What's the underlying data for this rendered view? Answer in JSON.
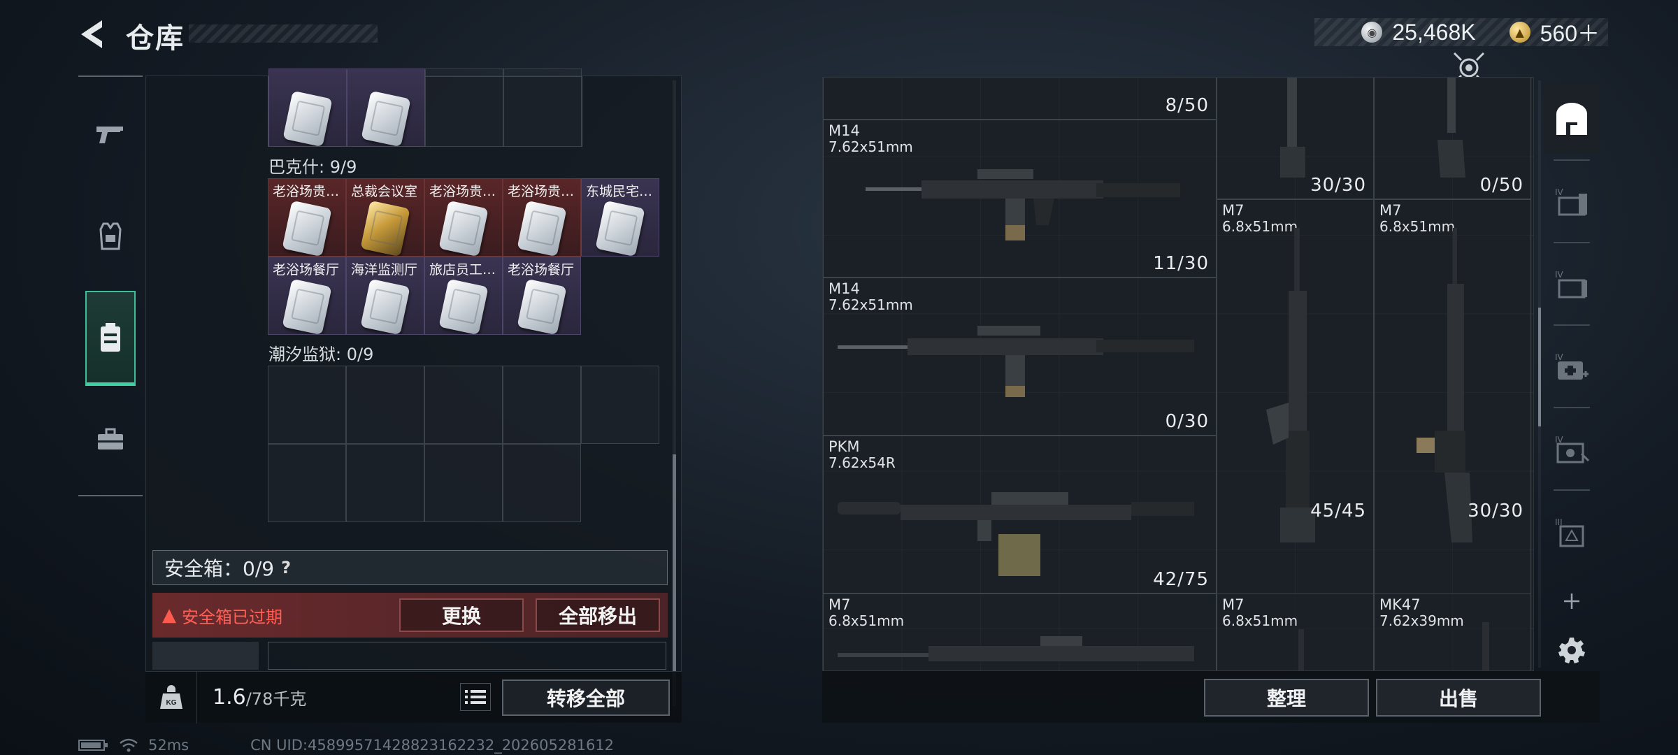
{
  "header": {
    "title": "仓库"
  },
  "currency": {
    "silver": "25,468K",
    "gold": "560＋"
  },
  "left_nav": [
    {
      "id": "weapons",
      "icon": "pistol-icon"
    },
    {
      "id": "armor",
      "icon": "vest-icon"
    },
    {
      "id": "cards",
      "icon": "keycard-case-icon",
      "active": true
    },
    {
      "id": "cases",
      "icon": "toolbox-icon"
    }
  ],
  "inventory": {
    "sections": [
      {
        "label": "巴克什: 9/9",
        "items": [
          {
            "name": "老浴场贵…",
            "rarity": "red"
          },
          {
            "name": "总裁会议室",
            "rarity": "red",
            "gold": true
          },
          {
            "name": "老浴场贵…",
            "rarity": "red"
          },
          {
            "name": "老浴场贵…",
            "rarity": "red"
          },
          {
            "name": "东城民宅…",
            "rarity": "purple"
          },
          {
            "name": "老浴场餐厅",
            "rarity": "purple"
          },
          {
            "name": "海洋监测厅",
            "rarity": "purple"
          },
          {
            "name": "旅店员工…",
            "rarity": "purple"
          },
          {
            "name": "老浴场餐厅",
            "rarity": "purple"
          }
        ]
      },
      {
        "label": "潮汐监狱: 0/9"
      }
    ],
    "safe_box": {
      "label": "安全箱：0/9",
      "help": "?",
      "status": "安全箱已过期",
      "replace_label": "更换",
      "remove_all_label": "全部移出"
    },
    "weight": {
      "current": "1.6",
      "max": "/78千克"
    },
    "transfer_all_label": "转移全部"
  },
  "stash": {
    "items": [
      {
        "name": "",
        "caliber": "",
        "ammo": "8/50"
      },
      {
        "name": "",
        "caliber": "",
        "ammo": "30/30"
      },
      {
        "name": "",
        "caliber": "",
        "ammo": "0/50"
      },
      {
        "name": "M14",
        "caliber": "7.62x51mm",
        "ammo": "11/30"
      },
      {
        "name": "M7",
        "caliber": "6.8x51mm",
        "ammo": "45/45"
      },
      {
        "name": "M7",
        "caliber": "6.8x51mm",
        "ammo": "30/30"
      },
      {
        "name": "M14",
        "caliber": "7.62x51mm",
        "ammo": "0/30"
      },
      {
        "name": "PKM",
        "caliber": "7.62x54R",
        "ammo": "42/75"
      },
      {
        "name": "M7",
        "caliber": "6.8x51mm",
        "ammo": ""
      },
      {
        "name": "M7",
        "caliber": "6.8x51mm",
        "ammo": ""
      },
      {
        "name": "MK47",
        "caliber": "7.62x39mm",
        "ammo": ""
      }
    ],
    "sort_label": "整理",
    "sell_label": "出售"
  },
  "right_side": [
    {
      "icon": "stash-home-icon",
      "active": true
    },
    {
      "icon": "container-iv-icon"
    },
    {
      "icon": "container-iv-2-icon"
    },
    {
      "icon": "medical-iv-icon"
    },
    {
      "icon": "gear-iv-icon"
    },
    {
      "icon": "container-iii-icon"
    },
    {
      "icon": "add-icon"
    },
    {
      "icon": "settings-icon"
    }
  ],
  "status": {
    "ping": "52ms",
    "uid": "CN UID:4589957142882316223​2_202605281612"
  }
}
